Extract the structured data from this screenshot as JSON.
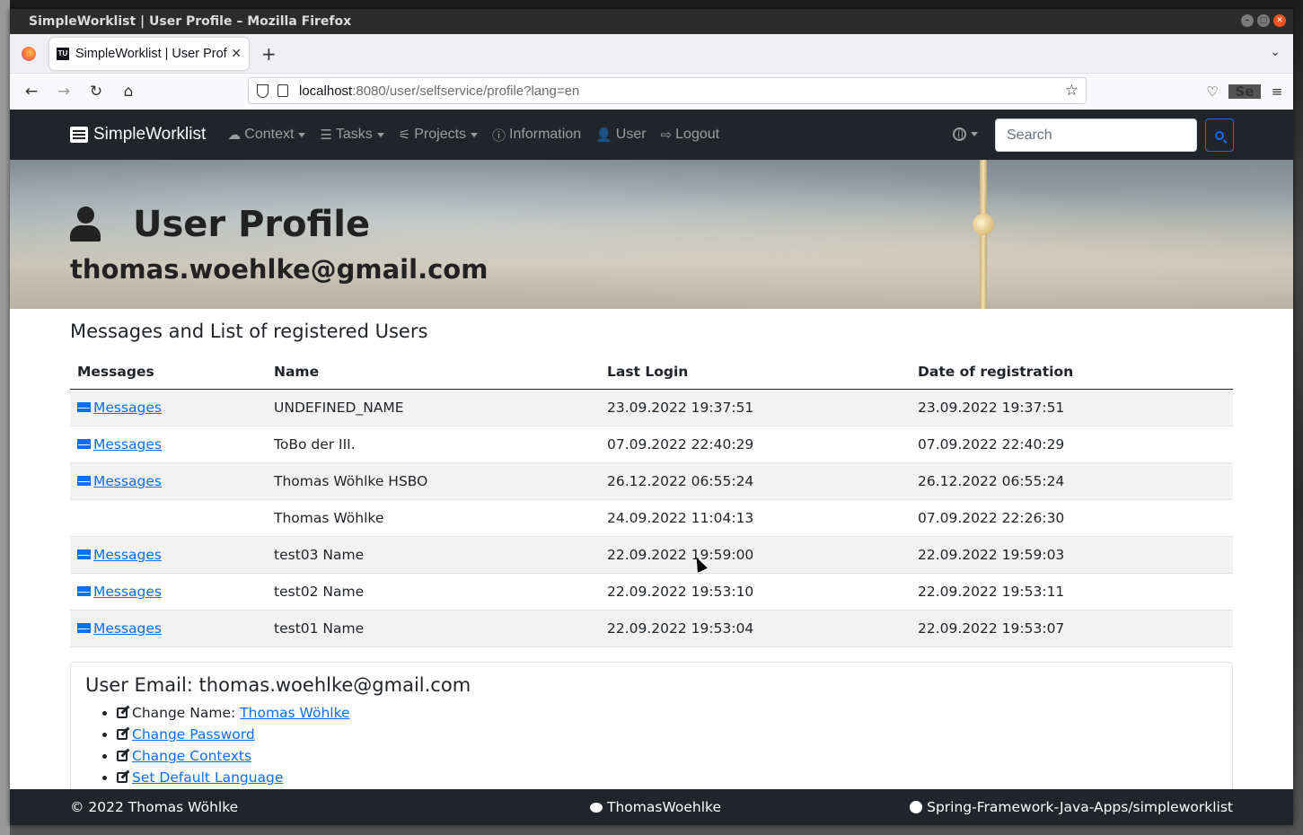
{
  "window": {
    "title": "SimpleWorklist | User Profile – Mozilla Firefox"
  },
  "browser": {
    "tab_title": "SimpleWorklist | User Profile",
    "url_host": "localhost",
    "url_path": ":8080/user/selfservice/profile?lang=en"
  },
  "app_nav": {
    "brand": "SimpleWorklist",
    "menu": {
      "context": "Context",
      "tasks": "Tasks",
      "projects": "Projects",
      "information": "Information",
      "user": "User",
      "logout": "Logout"
    },
    "search_placeholder": "Search"
  },
  "hero": {
    "title": "User Profile",
    "email": "thomas.woehlke@gmail.com"
  },
  "section": {
    "title": "Messages and List of registered Users",
    "columns": [
      "Messages",
      "Name",
      "Last Login",
      "Date of registration"
    ],
    "rows": [
      {
        "messages": "Messages",
        "name": "UNDEFINED_NAME",
        "last_login": "23.09.2022 19:37:51",
        "registered": "23.09.2022 19:37:51"
      },
      {
        "messages": "Messages",
        "name": "ToBo der III.",
        "last_login": "07.09.2022 22:40:29",
        "registered": "07.09.2022 22:40:29"
      },
      {
        "messages": "Messages",
        "name": "Thomas Wöhlke HSBO",
        "last_login": "26.12.2022 06:55:24",
        "registered": "26.12.2022 06:55:24"
      },
      {
        "messages": "",
        "name": "Thomas Wöhlke",
        "last_login": "24.09.2022 11:04:13",
        "registered": "07.09.2022 22:26:30"
      },
      {
        "messages": "Messages",
        "name": "test03 Name",
        "last_login": "22.09.2022 19:59:00",
        "registered": "22.09.2022 19:59:03"
      },
      {
        "messages": "Messages",
        "name": "test02 Name",
        "last_login": "22.09.2022 19:53:10",
        "registered": "22.09.2022 19:53:11"
      },
      {
        "messages": "Messages",
        "name": "test01 Name",
        "last_login": "22.09.2022 19:53:04",
        "registered": "22.09.2022 19:53:07"
      }
    ]
  },
  "card": {
    "title": "User Email: thomas.woehlke@gmail.com",
    "change_name_label": "Change Name:",
    "change_name_value": "Thomas Wöhlke",
    "change_password": "Change Password",
    "change_contexts": "Change Contexts",
    "set_default_language": "Set Default Language"
  },
  "footer": {
    "copyright": "© 2022 Thomas Wöhlke",
    "twitter": "ThomasWoehlke",
    "github": "Spring-Framework-Java-Apps/simpleworklist"
  },
  "colors": {
    "navbar": "#212529",
    "link": "#0d6efd",
    "firefox_close": "#e95420"
  }
}
